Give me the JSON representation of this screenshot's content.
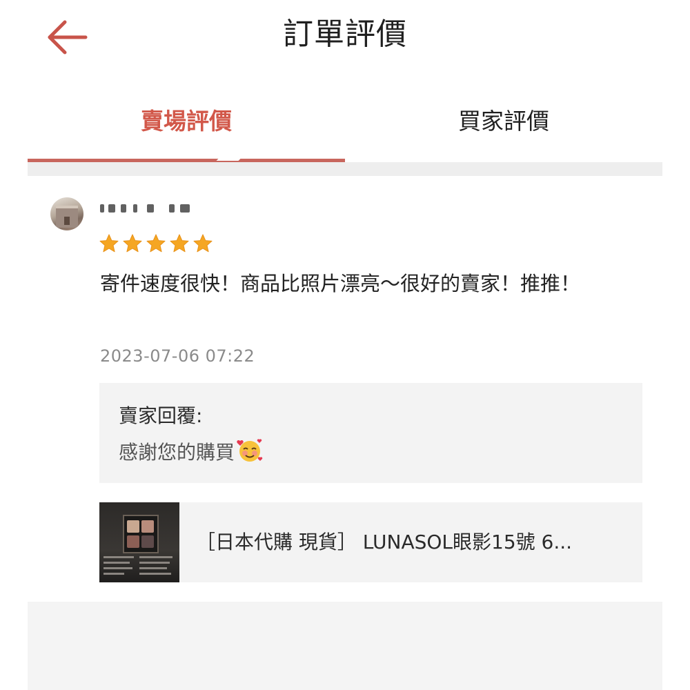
{
  "header": {
    "title": "訂單評價",
    "back_icon": "arrow-left-icon"
  },
  "colors": {
    "accent": "#d2584a",
    "star": "#f5a623",
    "timestamp": "#8a8a8a",
    "panel_bg": "#f3f3f3"
  },
  "tabs": [
    {
      "label": "賣場評價",
      "active": true
    },
    {
      "label": "買家評價",
      "active": false
    }
  ],
  "review": {
    "rating": 5,
    "rating_max": 5,
    "comment": "寄件速度很快！商品比照片漂亮～很好的賣家！推推！",
    "timestamp": "2023-07-06 07:22",
    "reply": {
      "label": "賣家回覆:",
      "text": "感謝您的購買",
      "emoji": "smiling-face-with-hearts-icon"
    },
    "product": {
      "name": "［日本代購 現貨］ LUNASOL眼影15號 6...",
      "thumbnail_icon": "eyeshadow-palette-image"
    }
  }
}
